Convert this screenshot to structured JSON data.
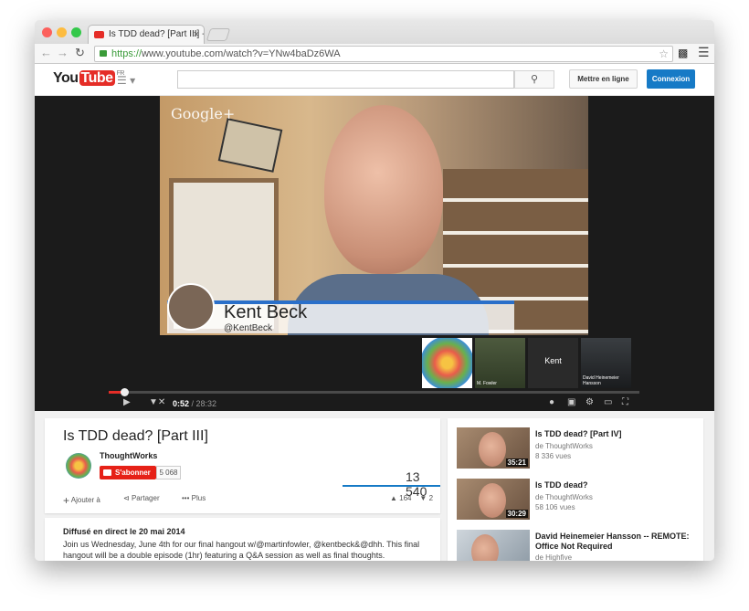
{
  "browser": {
    "tab_title": "Is TDD dead? [Part III] - Yo",
    "tab_close": "×",
    "url_https": "https://",
    "url_rest": "www.youtube.com/watch?v=YNw4baDz6WA"
  },
  "header": {
    "logo_you": "You",
    "logo_tube": "Tube",
    "logo_region": "FR",
    "search_placeholder": "",
    "upload_label": "Mettre en ligne",
    "login_label": "Connexion"
  },
  "player": {
    "overlay_brand": "Google+",
    "speaker_name": "Kent Beck",
    "speaker_handle": "@KentBeck",
    "participant_label": "Kent",
    "thumb_martin_label": "M. Fowler",
    "thumb_dhh_label": "David Heinemeier Hansson",
    "current_time": "0:52",
    "duration": "/ 28:32",
    "progress_fraction": 0.03
  },
  "video": {
    "title": "Is TDD dead? [Part III]",
    "channel": "ThoughtWorks",
    "subscribe_label": "S'abonner",
    "subscriber_count": "5 068",
    "views": "13 540",
    "add_to_label": "Ajouter à",
    "share_label": "Partager",
    "more_label": "Plus",
    "like_count": "164",
    "dislike_count": "2"
  },
  "description": {
    "heading": "Diffusé en direct le 20 mai 2014",
    "text": "Join us Wednesday, June 4th for our final hangout  w/@martinfowler, @kentbeck&@dhh. This final hangout will be a double episode (1hr) featuring a Q&A session as well as final thoughts."
  },
  "recommendations": [
    {
      "title": "Is TDD dead? [Part IV]",
      "by": "de ThoughtWorks",
      "views": "8 336 vues",
      "duration": "35:21"
    },
    {
      "title": "Is TDD dead?",
      "by": "de ThoughtWorks",
      "views": "58 106 vues",
      "duration": "30:29"
    },
    {
      "title": "David Heinemeier Hansson -- REMOTE: Office Not Required",
      "by": "de Highfive",
      "views": "",
      "duration": ""
    }
  ]
}
